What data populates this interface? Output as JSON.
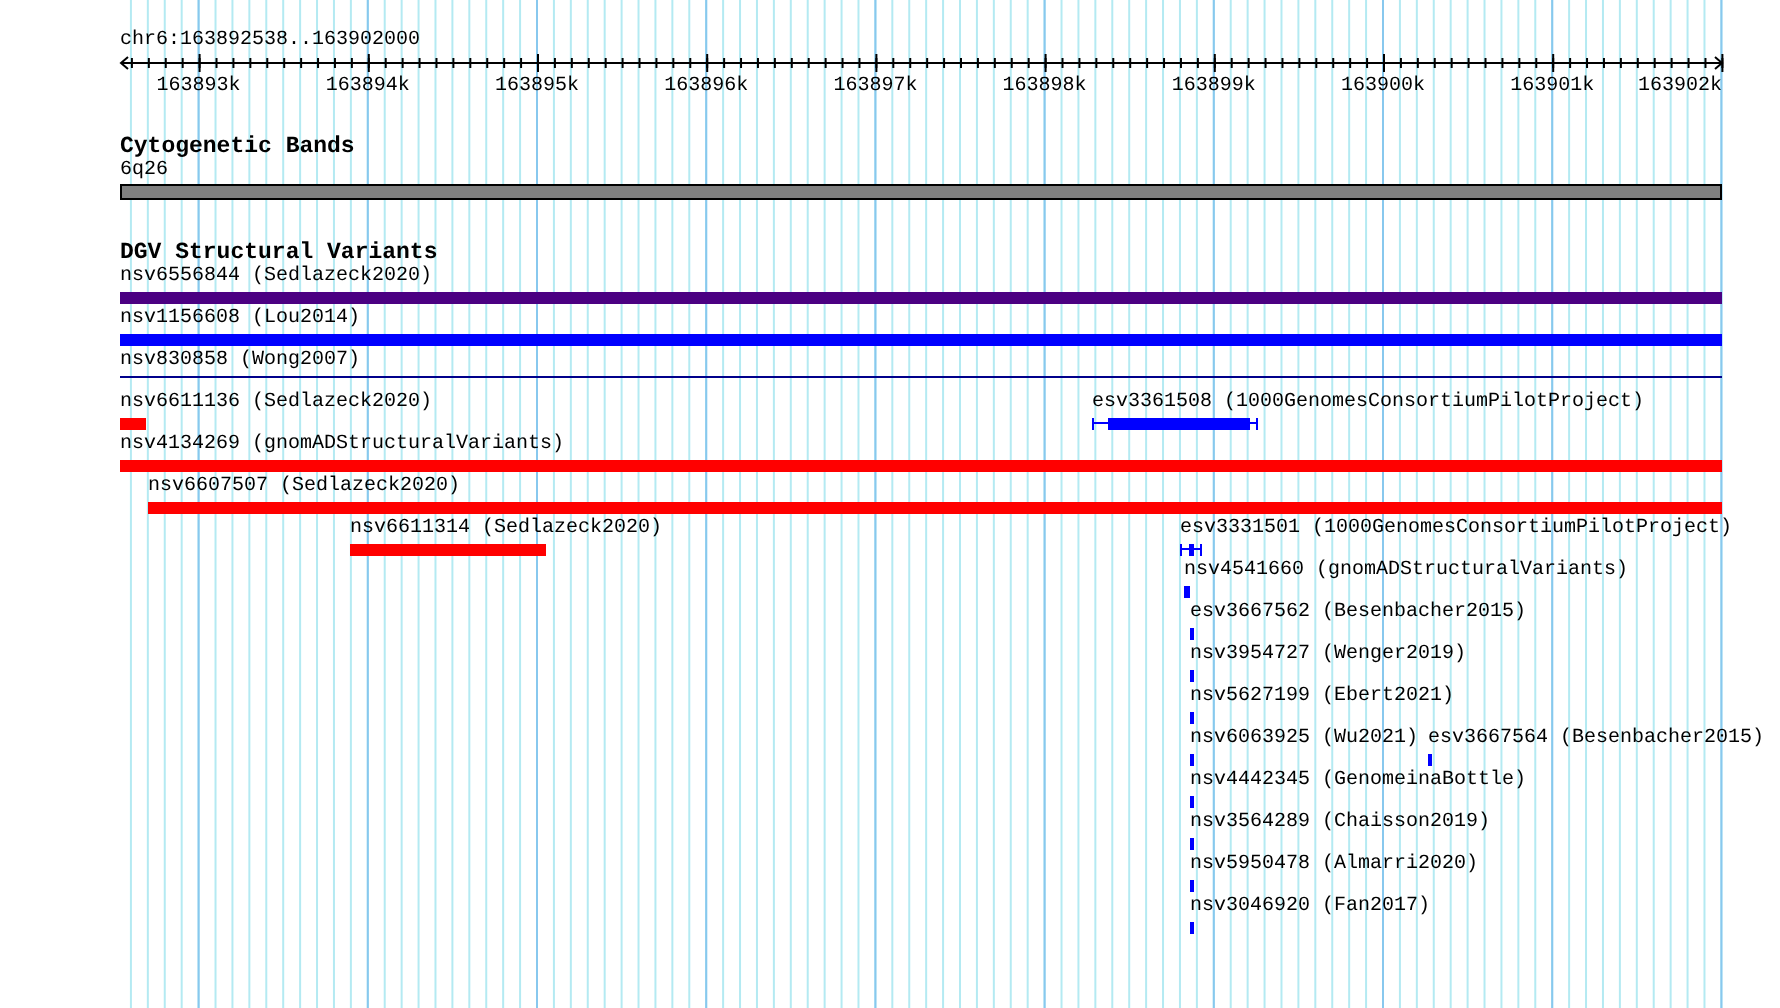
{
  "location": "chr6:163892538..163902000",
  "ruler": {
    "labels": [
      "163893k",
      "163894k",
      "163895k",
      "163896k",
      "163897k",
      "163898k",
      "163899k",
      "163900k",
      "163901k",
      "163902k"
    ]
  },
  "cytoband_track": {
    "title": "Cytogenetic Bands",
    "band": "6q26"
  },
  "dgv_track": {
    "title": "DGV Structural Variants",
    "rows": [
      {
        "features": [
          {
            "label": "nsv6556844 (Sedlazeck2020)",
            "kind": "bar",
            "color": "#4b0082"
          }
        ]
      },
      {
        "features": [
          {
            "label": "nsv1156608 (Lou2014)",
            "kind": "bar",
            "color": "#0000ff"
          }
        ]
      },
      {
        "features": [
          {
            "label": "nsv830858 (Wong2007)",
            "kind": "line",
            "color": "#00008b"
          }
        ]
      },
      {
        "features": [
          {
            "label": "nsv6611136 (Sedlazeck2020)",
            "kind": "bar",
            "color": "#ff0000"
          },
          {
            "label": "esv3361508 (1000GenomesConsortiumPilotProject)",
            "kind": "bracketed",
            "color": "#0000ff"
          }
        ]
      },
      {
        "features": [
          {
            "label": "nsv4134269 (gnomADStructuralVariants)",
            "kind": "bar",
            "color": "#ff0000"
          }
        ]
      },
      {
        "features": [
          {
            "label": "nsv6607507 (Sedlazeck2020)",
            "kind": "bar",
            "color": "#ff0000"
          }
        ]
      },
      {
        "features": [
          {
            "label": "nsv6611314 (Sedlazeck2020)",
            "kind": "bar",
            "color": "#ff0000"
          },
          {
            "label": "esv3331501 (1000GenomesConsortiumPilotProject)",
            "kind": "bracketed",
            "color": "#0000ff"
          }
        ]
      },
      {
        "features": [
          {
            "label": "nsv4541660 (gnomADStructuralVariants)",
            "kind": "bar",
            "color": "#0000ff"
          }
        ]
      },
      {
        "features": [
          {
            "label": "esv3667562 (Besenbacher2015)",
            "kind": "bar",
            "color": "#0000ff"
          }
        ]
      },
      {
        "features": [
          {
            "label": "nsv3954727 (Wenger2019)",
            "kind": "bar",
            "color": "#0000ff"
          }
        ]
      },
      {
        "features": [
          {
            "label": "nsv5627199 (Ebert2021)",
            "kind": "bar",
            "color": "#0000ff"
          }
        ]
      },
      {
        "features": [
          {
            "label": "nsv6063925 (Wu2021)",
            "kind": "bar",
            "color": "#0000ff"
          },
          {
            "label": "esv3667564 (Besenbacher2015)",
            "kind": "bar",
            "color": "#0000ff"
          }
        ]
      },
      {
        "features": [
          {
            "label": "nsv4442345 (GenomeinaBottle)",
            "kind": "bar",
            "color": "#0000ff"
          }
        ]
      },
      {
        "features": [
          {
            "label": "nsv3564289 (Chaisson2019)",
            "kind": "bar",
            "color": "#0000ff"
          }
        ]
      },
      {
        "features": [
          {
            "label": "nsv5950478 (Almarri2020)",
            "kind": "bar",
            "color": "#0000ff"
          }
        ]
      },
      {
        "features": [
          {
            "label": "nsv3046920 (Fan2017)",
            "kind": "bar",
            "color": "#0000ff"
          }
        ]
      }
    ]
  }
}
